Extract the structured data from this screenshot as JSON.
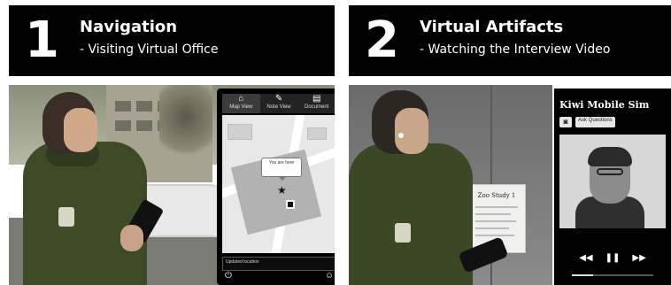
{
  "panels": [
    {
      "number": "1",
      "title": "Navigation",
      "subtitle": "- Visiting Virtual Office",
      "app": {
        "tabs": [
          {
            "label": "Map View",
            "icon": "map-icon"
          },
          {
            "label": "Note View",
            "icon": "pencil-icon"
          },
          {
            "label": "Document",
            "icon": "document-icon"
          }
        ],
        "map_callout": "You are here",
        "status_text": "Updated location",
        "bottom_icons": [
          "power-icon",
          "person-icon"
        ]
      }
    },
    {
      "number": "2",
      "title": "Virtual Artifacts",
      "subtitle": "- Watching the Interview Video",
      "poster_text": "Zoo Study 1",
      "player": {
        "title": "Kiwi Mobile Sim",
        "buttons": [
          "camera-icon",
          "Ask Questions"
        ],
        "controls": [
          "rewind-icon",
          "pause-icon",
          "fast-forward-icon"
        ],
        "progress": 0.26
      }
    }
  ]
}
